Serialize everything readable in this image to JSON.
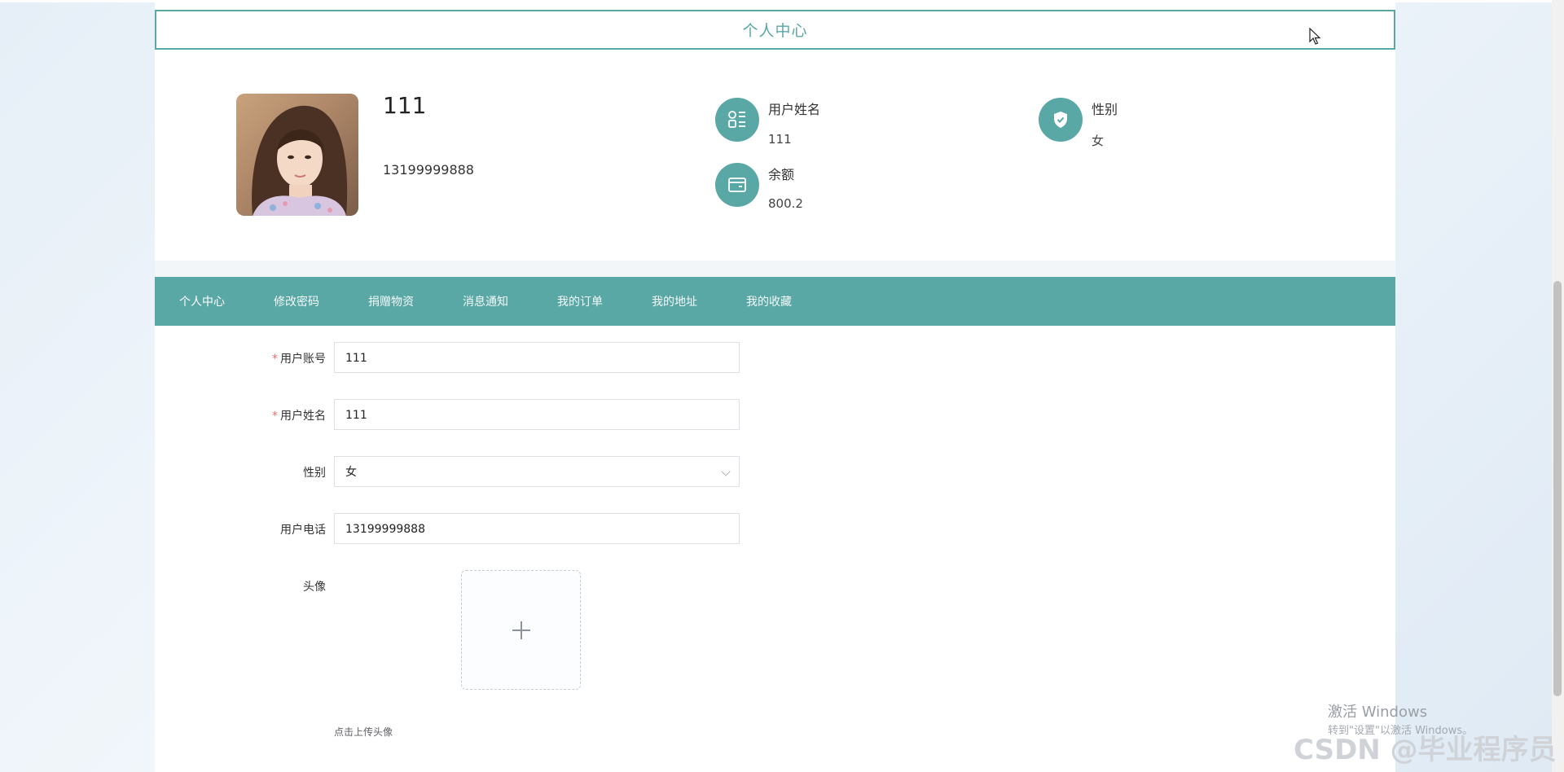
{
  "page": {
    "title": "个人中心"
  },
  "profile": {
    "username": "111",
    "phone": "13199999888",
    "fields": [
      {
        "icon": "apps-icon",
        "label": "用户姓名",
        "value": "111"
      },
      {
        "icon": "shield-check-icon",
        "label": "性别",
        "value": "女"
      },
      {
        "icon": "wallet-icon",
        "label": "余额",
        "value": "800.2"
      }
    ]
  },
  "nav": {
    "items": [
      "个人中心",
      "修改密码",
      "捐赠物资",
      "消息通知",
      "我的订单",
      "我的地址",
      "我的收藏"
    ]
  },
  "form": {
    "account": {
      "label": "用户账号",
      "value": "111"
    },
    "name": {
      "label": "用户姓名",
      "value": "111"
    },
    "gender": {
      "label": "性别",
      "value": "女"
    },
    "phone": {
      "label": "用户电话",
      "value": "13199999888"
    },
    "avatar": {
      "label": "头像",
      "tip": "点击上传头像"
    }
  },
  "overlay": {
    "activate_title": "激活 Windows",
    "activate_sub": "转到\"设置\"以激活 Windows。",
    "watermark": "CSDN @毕业程序员"
  },
  "colors": {
    "accent": "#5aa8a6",
    "required": "#f56c6c"
  }
}
